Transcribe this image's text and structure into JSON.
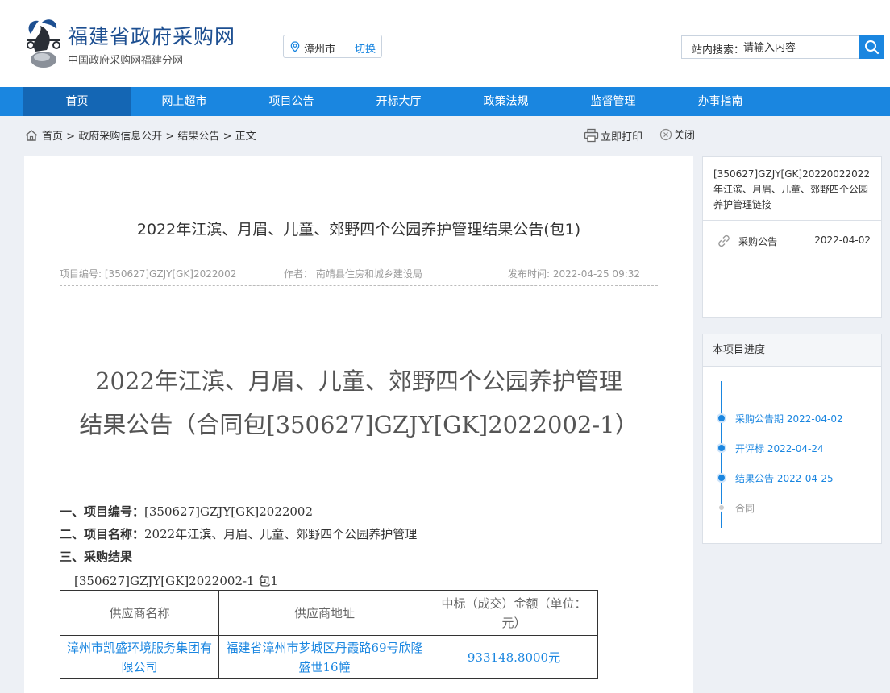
{
  "header": {
    "site_title": "福建省政府采购网",
    "site_subtitle": "中国政府采购网福建分网",
    "city": "漳州市",
    "city_switch": "切换",
    "search_label": "站内搜索：",
    "search_placeholder": "请输入内容"
  },
  "nav": {
    "items": [
      {
        "label": "首页",
        "active": true
      },
      {
        "label": "网上超市"
      },
      {
        "label": "项目公告"
      },
      {
        "label": "开标大厅"
      },
      {
        "label": "政策法规"
      },
      {
        "label": "监督管理"
      },
      {
        "label": "办事指南"
      }
    ]
  },
  "breadcrumb": {
    "home": "首页",
    "path": [
      "政府采购信息公开",
      "结果公告",
      "正文"
    ],
    "separator": ">"
  },
  "tools": {
    "print_label": "立即打印",
    "close_label": "关闭"
  },
  "article": {
    "title": "2022年江滨、月眉、儿童、郊野四个公园养护管理结果公告(包1)",
    "meta": {
      "project_no_label": "项目编号:",
      "project_no": "[350627]GZJY[GK]2022002",
      "author_label": "作者：",
      "author": "南靖县住房和城乡建设局",
      "publish_label": "发布时间:",
      "publish_time": "2022-04-25 09:32"
    },
    "big_title_line1": "2022年江滨、月眉、儿童、郊野四个公园养护管理",
    "big_title_line2": "结果公告（合同包[350627]GZJY[GK]2022002-1）",
    "section1_label": "一、项目编号：",
    "section1_value": "[350627]GZJY[GK]2022002",
    "section2_label": "二、项目名称：",
    "section2_value": "2022年江滨、月眉、儿童、郊野四个公园养护管理",
    "section3_label": "三、采购结果",
    "package_line": "[350627]GZJY[GK]2022002-1 包1",
    "table": {
      "headers": [
        "供应商名称",
        "供应商地址",
        "中标（成交）金额（单位：元）"
      ],
      "rows": [
        [
          "漳州市凯盛环境服务集团有限公司",
          "福建省漳州市芗城区丹霞路69号欣隆盛世16幢",
          "933148.8000元"
        ]
      ]
    }
  },
  "sidebar": {
    "link_title": "[350627]GZJY[GK]20220022022年江滨、月眉、儿童、郊野四个公园养护管理链接",
    "links": [
      {
        "label": "采购公告",
        "date": "2022-04-02"
      }
    ],
    "progress_title": "本项目进度",
    "progress": [
      {
        "label": "采购公告期",
        "date": "2022-04-02",
        "done": true
      },
      {
        "label": "开评标",
        "date": "2022-04-24",
        "done": true
      },
      {
        "label": "结果公告",
        "date": "2022-04-25",
        "done": true
      },
      {
        "label": "合同",
        "date": "",
        "done": false
      }
    ]
  },
  "colors": {
    "primary": "#1a86e0",
    "nav_active": "#1466b4",
    "title_blue": "#1d4f91",
    "page_bg": "#edf0f5"
  }
}
